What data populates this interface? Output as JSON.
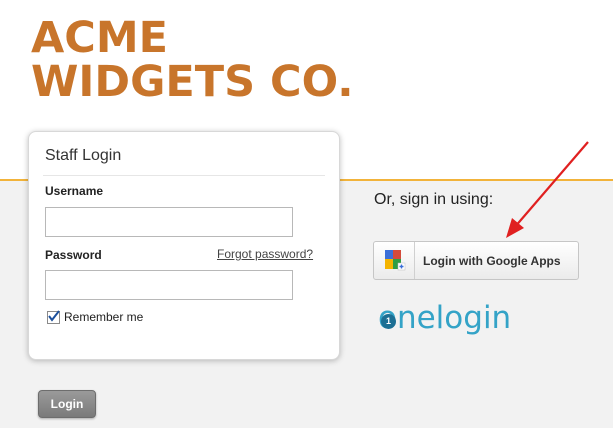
{
  "brand": {
    "line1": "ACME",
    "line2": "WIDGETS CO.",
    "color": "#c8752b"
  },
  "login_card": {
    "title": "Staff Login",
    "username_label": "Username",
    "username_value": "",
    "password_label": "Password",
    "password_value": "",
    "forgot_link": "Forgot password?",
    "remember_label": "Remember me",
    "remember_checked": true
  },
  "login_button": {
    "label": "Login"
  },
  "alt_signin": {
    "heading": "Or, sign in using:",
    "google_button": "Login with Google Apps",
    "google_icon": "google-apps-icon",
    "onelogin_text": "onelogin",
    "onelogin_badge": "1"
  },
  "colors": {
    "accent_band": "#f2b33a",
    "annotation_arrow": "#e02020",
    "onelogin": "#34a3c7"
  }
}
